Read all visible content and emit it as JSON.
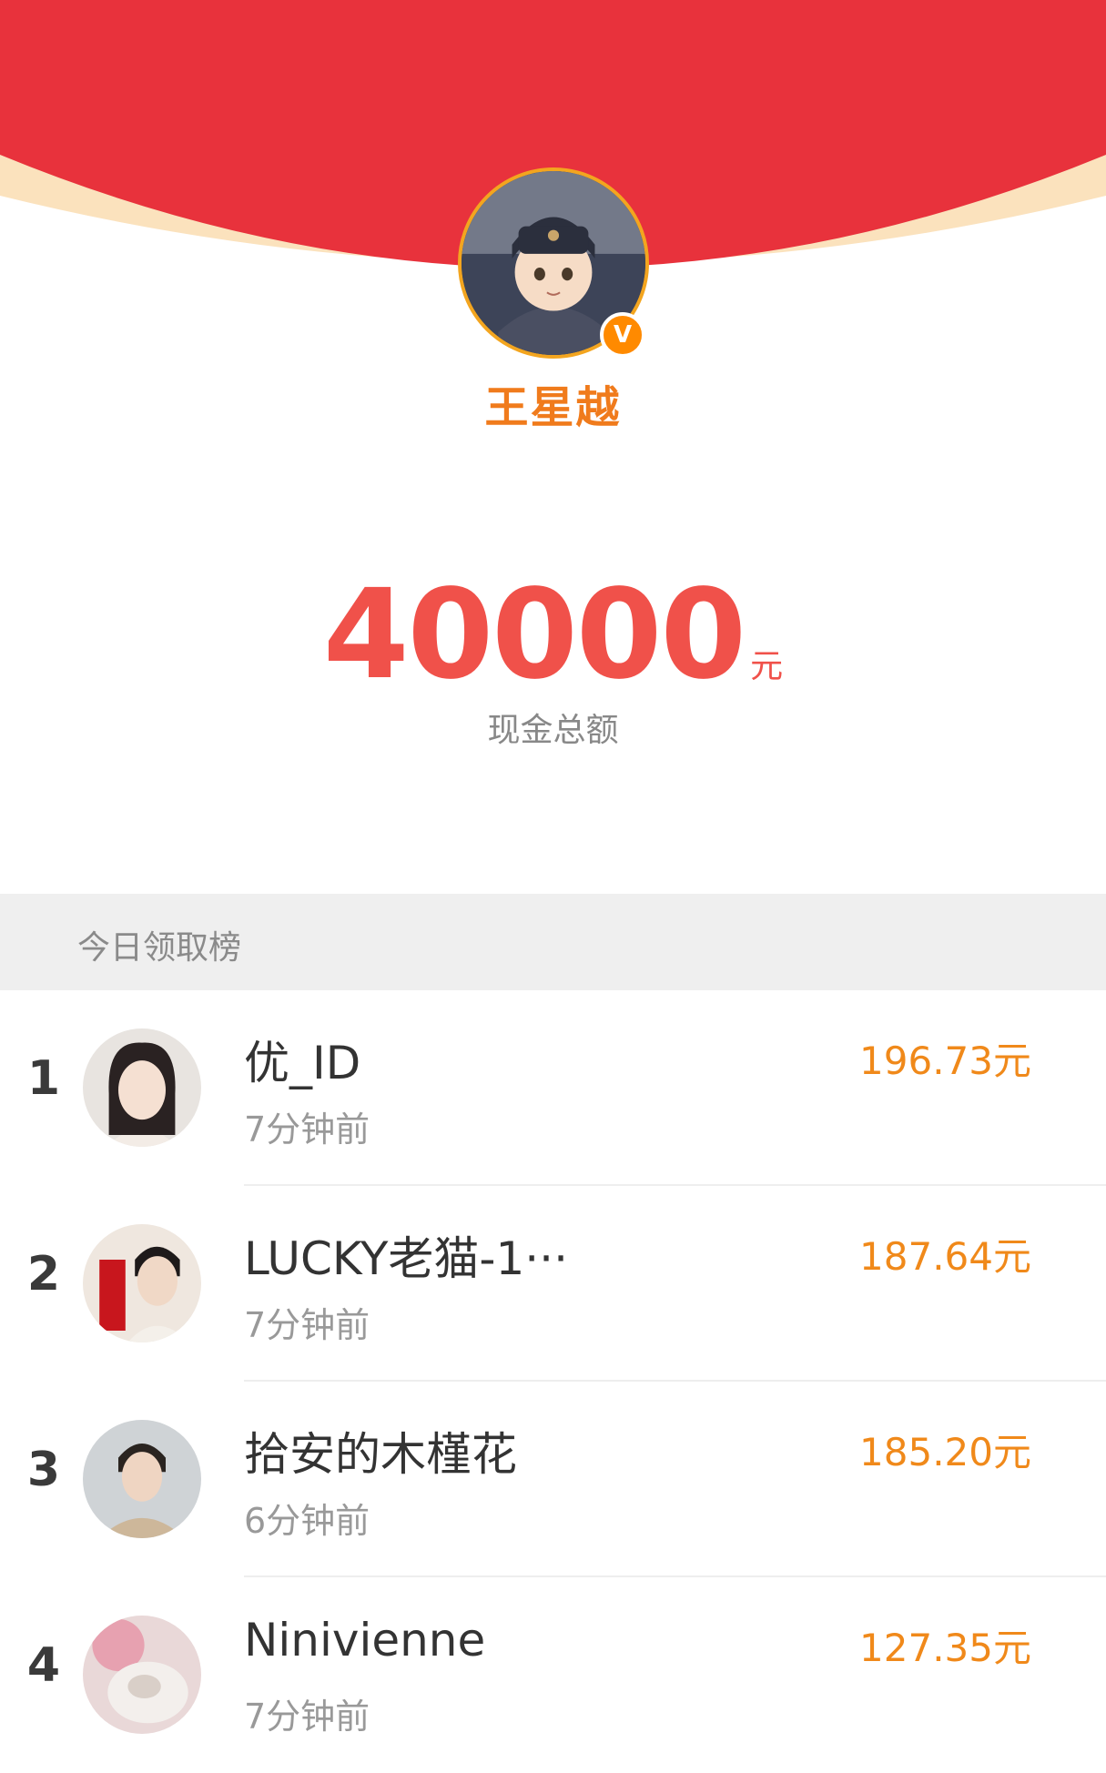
{
  "header": {
    "username": "王星越",
    "verified_badge": "V",
    "colors": {
      "red": "#e8323c",
      "cream": "#fbe2bd",
      "name": "#f07b1c"
    }
  },
  "summary": {
    "total_amount": "40000",
    "unit": "元",
    "label": "现金总额"
  },
  "leaderboard": {
    "title": "今日领取榜",
    "rows": [
      {
        "rank": "1",
        "name": "优_ID",
        "time": "7分钟前",
        "amount": "196.73元"
      },
      {
        "rank": "2",
        "name": "LUCKY老猫-1···",
        "time": "7分钟前",
        "amount": "187.64元"
      },
      {
        "rank": "3",
        "name": "拾安的木槿花",
        "time": "6分钟前",
        "amount": "185.20元"
      },
      {
        "rank": "4",
        "name": "Ninivienne",
        "time": "7分钟前",
        "amount": "127.35元"
      }
    ]
  }
}
